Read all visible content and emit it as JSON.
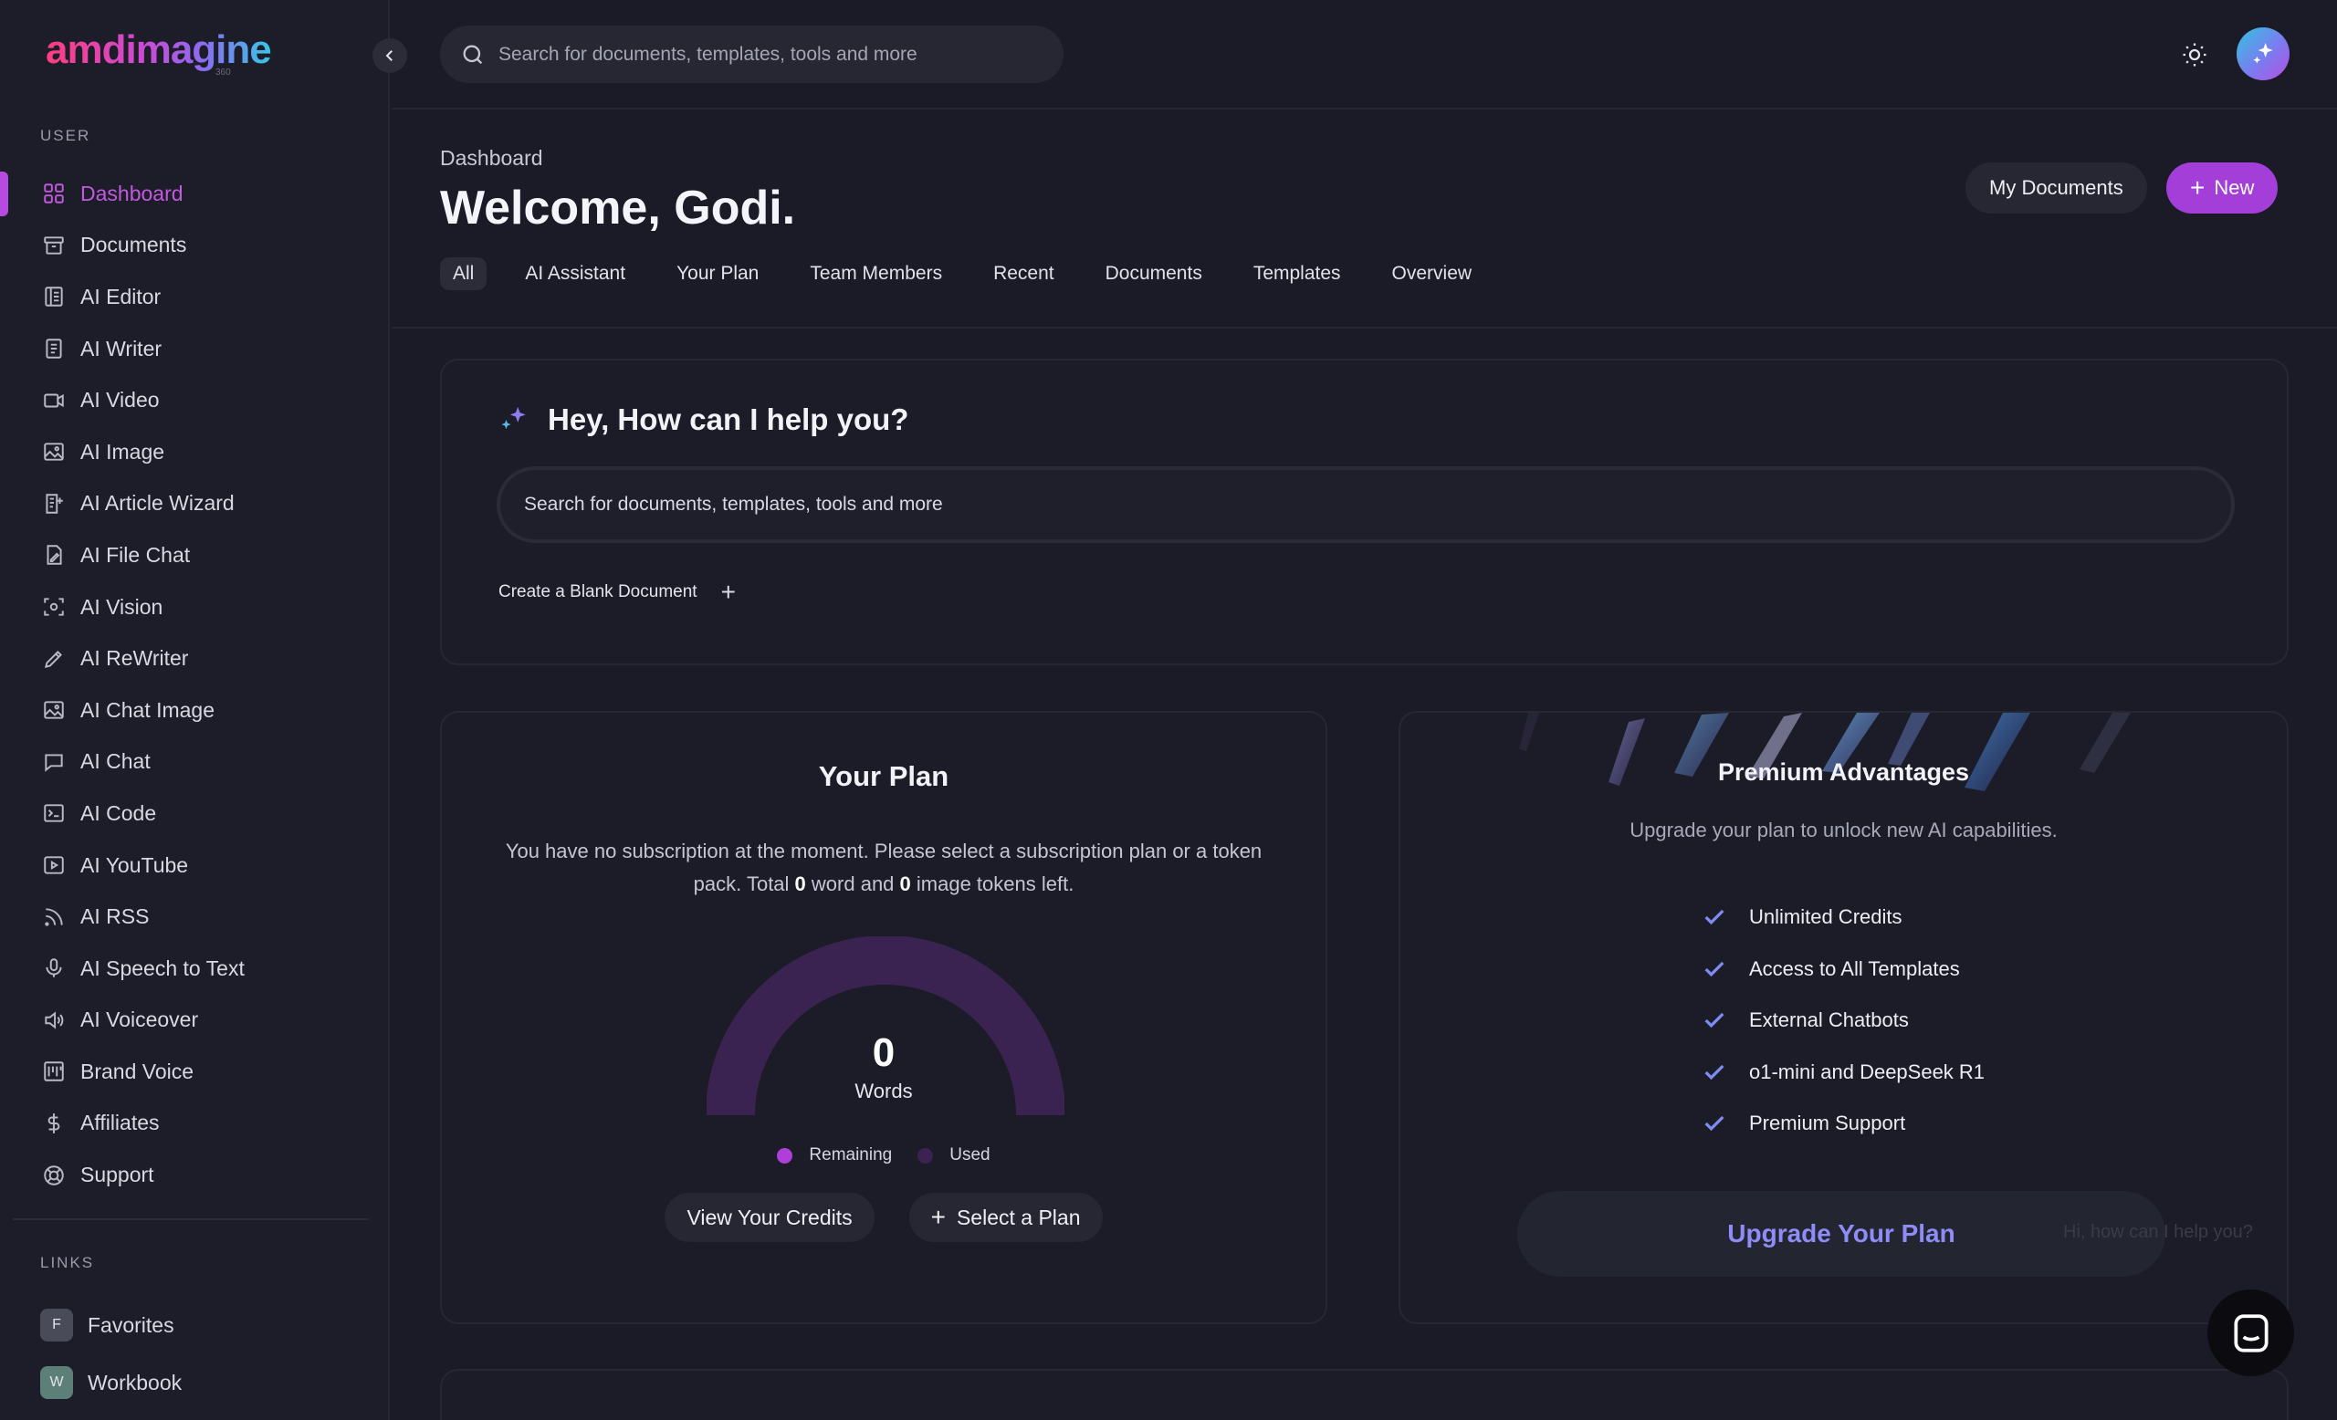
{
  "app": {
    "logo_text": "amdimagine",
    "logo_sub": "360"
  },
  "colors": {
    "background": "#1a1b26",
    "accent": "#a33ed8",
    "active_nav": "#c25ae0",
    "upgrade_text": "#8e8cf6",
    "gauge_remaining": "#b03ed8",
    "gauge_used": "#3a2350"
  },
  "sidebar": {
    "user_label": "USER",
    "items": [
      {
        "label": "Dashboard",
        "icon": "dashboard-grid-icon"
      },
      {
        "label": "Documents",
        "icon": "archive-icon"
      },
      {
        "label": "AI Editor",
        "icon": "editor-icon"
      },
      {
        "label": "AI Writer",
        "icon": "document-text-icon"
      },
      {
        "label": "AI Video",
        "icon": "video-icon"
      },
      {
        "label": "AI Image",
        "icon": "image-icon"
      },
      {
        "label": "AI Article Wizard",
        "icon": "article-wizard-icon"
      },
      {
        "label": "AI File Chat",
        "icon": "file-chat-icon"
      },
      {
        "label": "AI Vision",
        "icon": "scan-eye-icon"
      },
      {
        "label": "AI ReWriter",
        "icon": "pen-icon"
      },
      {
        "label": "AI Chat Image",
        "icon": "image-icon"
      },
      {
        "label": "AI Chat",
        "icon": "chat-bubble-icon"
      },
      {
        "label": "AI Code",
        "icon": "terminal-icon"
      },
      {
        "label": "AI YouTube",
        "icon": "play-icon"
      },
      {
        "label": "AI RSS",
        "icon": "rss-icon"
      },
      {
        "label": "AI Speech to Text",
        "icon": "microphone-icon"
      },
      {
        "label": "AI Voiceover",
        "icon": "speaker-icon"
      },
      {
        "label": "Brand Voice",
        "icon": "brand-voice-icon"
      },
      {
        "label": "Affiliates",
        "icon": "dollar-icon"
      },
      {
        "label": "Support",
        "icon": "lifebuoy-icon"
      }
    ],
    "links_label": "LINKS",
    "links": [
      {
        "badge": "F",
        "label": "Favorites"
      },
      {
        "badge": "W",
        "label": "Workbook"
      }
    ]
  },
  "topbar": {
    "search_placeholder": "Search for documents, templates, tools and more"
  },
  "header": {
    "breadcrumb": "Dashboard",
    "title": "Welcome, Godi.",
    "my_documents": "My Documents",
    "new_label": "New",
    "tabs": [
      "All",
      "AI Assistant",
      "Your Plan",
      "Team Members",
      "Recent",
      "Documents",
      "Templates",
      "Overview"
    ]
  },
  "help": {
    "title": "Hey, How can I help you?",
    "search_placeholder": "Search for documents, templates, tools and more",
    "blank_doc": "Create a Blank Document"
  },
  "plan": {
    "title": "Your Plan",
    "text_before": "You have no subscription at the moment. Please select a subscription plan or a token pack. Total ",
    "words_left": "0",
    "text_mid": " word and ",
    "images_left": "0",
    "text_after": " image tokens left.",
    "gauge_value": "0",
    "gauge_unit": "Words",
    "gauge_remaining_fraction": 0,
    "legend_remaining": "Remaining",
    "legend_used": "Used",
    "view_credits": "View Your Credits",
    "select_plan": "Select a Plan"
  },
  "premium": {
    "title": "Premium Advantages",
    "subtitle": "Upgrade your plan to unlock new AI capabilities.",
    "features": [
      "Unlimited Credits",
      "Access to All Templates",
      "External Chatbots",
      "o1-mini and DeepSeek R1",
      "Premium Support"
    ],
    "upgrade": "Upgrade Your Plan",
    "ghost": "Hi, how can I help you?"
  }
}
